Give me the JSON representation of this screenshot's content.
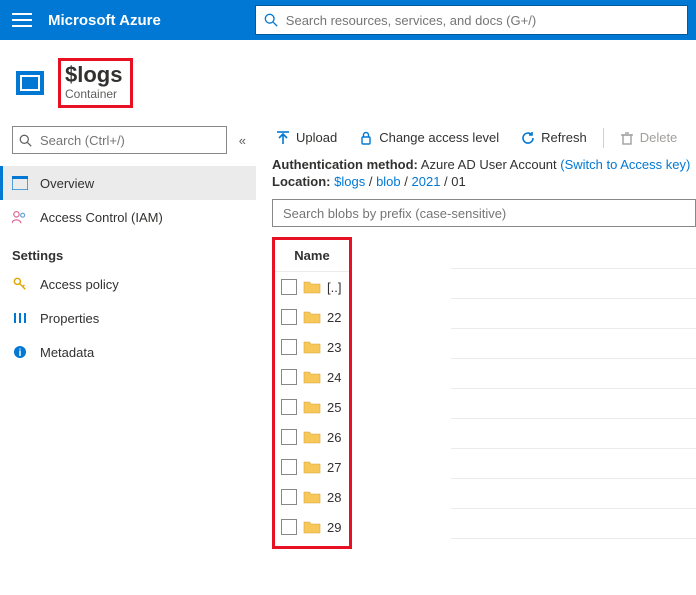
{
  "topbar": {
    "brand": "Microsoft Azure",
    "search_placeholder": "Search resources, services, and docs (G+/)"
  },
  "header": {
    "title": "$logs",
    "subtitle": "Container"
  },
  "sidebar": {
    "search_placeholder": "Search (Ctrl+/)",
    "items": [
      {
        "label": "Overview"
      },
      {
        "label": "Access Control (IAM)"
      }
    ],
    "section_label": "Settings",
    "settings_items": [
      {
        "label": "Access policy"
      },
      {
        "label": "Properties"
      },
      {
        "label": "Metadata"
      }
    ]
  },
  "toolbar": {
    "upload_label": "Upload",
    "access_label": "Change access level",
    "refresh_label": "Refresh",
    "delete_label": "Delete"
  },
  "meta": {
    "auth_label": "Authentication method:",
    "auth_value": "Azure AD User Account",
    "auth_link": "(Switch to Access key)",
    "location_label": "Location:",
    "crumb1": "$logs",
    "crumb2": "blob",
    "crumb3": "2021",
    "crumb4": "01"
  },
  "blob_search_placeholder": "Search blobs by prefix (case-sensitive)",
  "table": {
    "col_name": "Name",
    "rows": [
      {
        "name": "[..]"
      },
      {
        "name": "22"
      },
      {
        "name": "23"
      },
      {
        "name": "24"
      },
      {
        "name": "25"
      },
      {
        "name": "26"
      },
      {
        "name": "27"
      },
      {
        "name": "28"
      },
      {
        "name": "29"
      }
    ]
  }
}
